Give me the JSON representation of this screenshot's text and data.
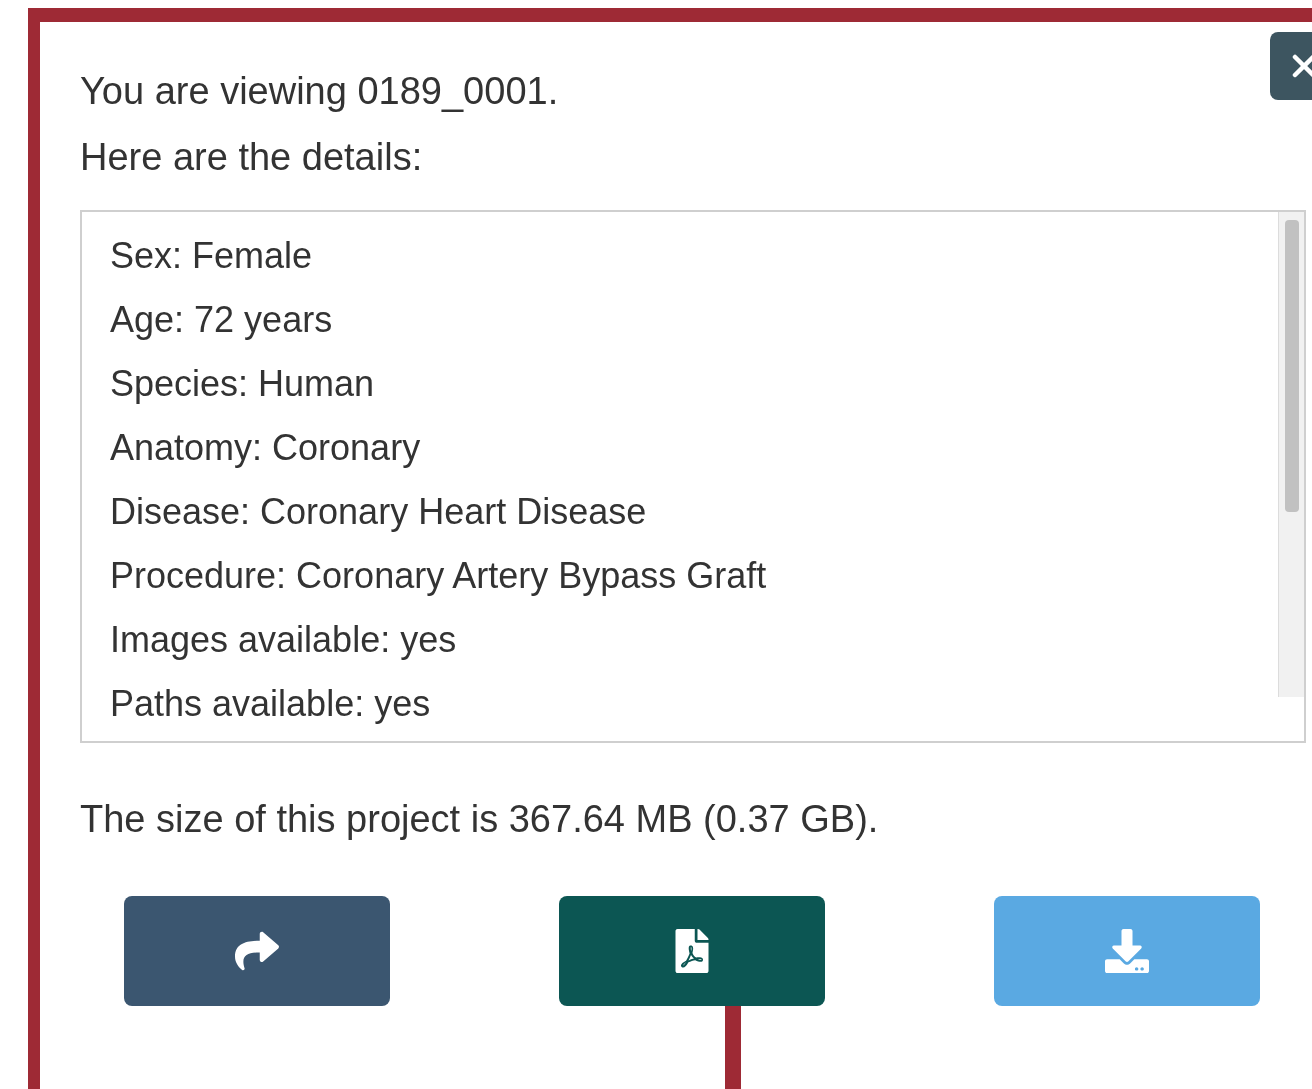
{
  "intro": [
    "You are viewing 0189_0001.",
    "Here are the details:"
  ],
  "details": [
    "Sex: Female",
    "Age: 72 years",
    "Species: Human",
    "Anatomy: Coronary",
    "Disease: Coronary Heart Disease",
    "Procedure: Coronary Artery Bypass Graft",
    "Images available: yes",
    "Paths available: yes"
  ],
  "size_text": "The size of this project is 367.64 MB (0.37 GB).",
  "buttons": [
    {
      "kind": "share"
    },
    {
      "kind": "pdf"
    },
    {
      "kind": "download"
    }
  ]
}
